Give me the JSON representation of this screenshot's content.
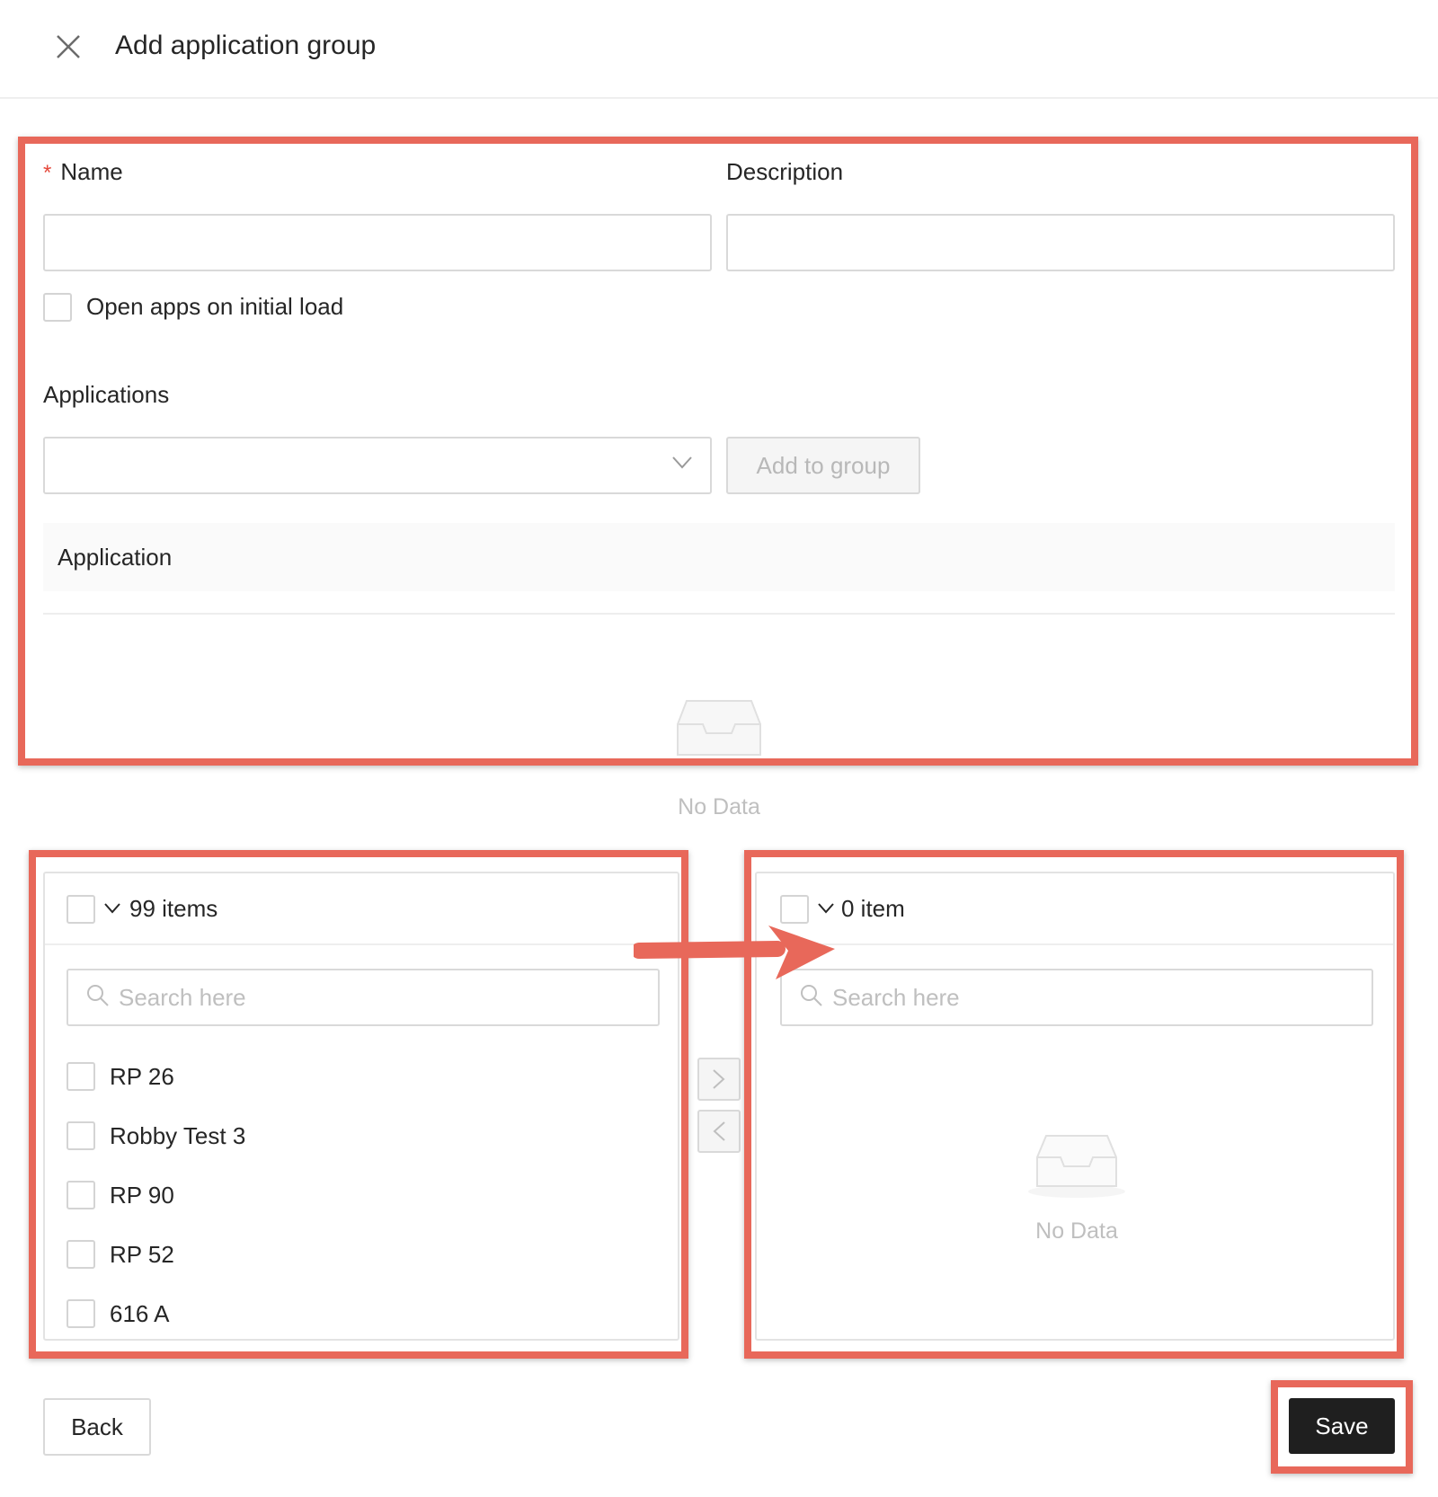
{
  "dialog": {
    "title": "Add application group",
    "close_icon": "close-icon"
  },
  "form": {
    "name_required_mark": "*",
    "name_label": "Name",
    "name_value": "",
    "description_label": "Description",
    "description_value": "",
    "open_apps_label": "Open apps on initial load",
    "open_apps_checked": false,
    "applications_label": "Applications",
    "applications_selected": "",
    "add_to_group_label": "Add to group",
    "table_column": "Application",
    "table_empty": "No Data"
  },
  "transfer": {
    "left": {
      "count_label": "99 items",
      "search_placeholder": "Search here",
      "items": [
        "RP 26",
        "Robby Test 3",
        "RP 90",
        "RP 52",
        "616 A"
      ]
    },
    "right": {
      "count_label": "0 item",
      "search_placeholder": "Search here",
      "empty_label": "No Data"
    }
  },
  "footer": {
    "back_label": "Back",
    "save_label": "Save"
  },
  "colors": {
    "annotation": "#e8685a",
    "primary_button": "#1f1f1f",
    "required": "#e5483b"
  }
}
